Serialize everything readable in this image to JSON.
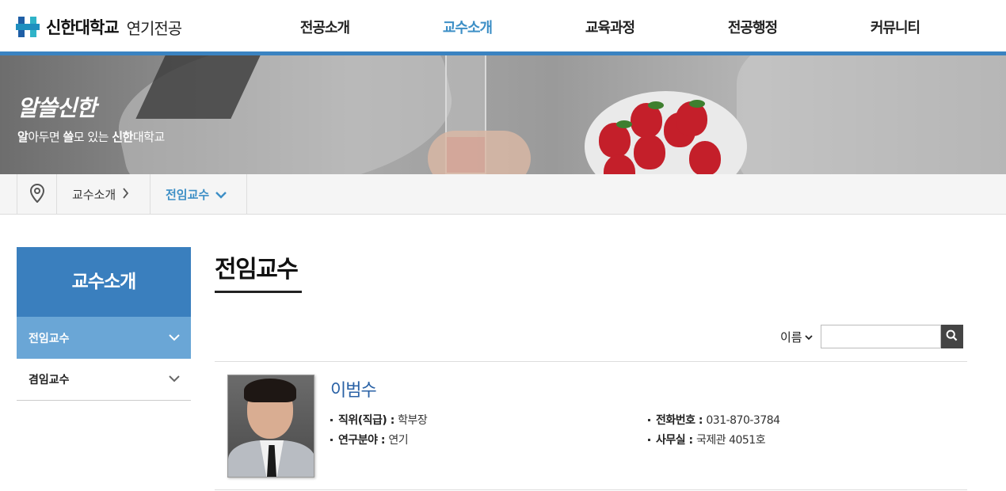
{
  "header": {
    "logo_univ": "신한대학교",
    "logo_major": "연기전공",
    "nav": [
      "전공소개",
      "교수소개",
      "교육과정",
      "전공행정",
      "커뮤니티"
    ],
    "active_nav": "교수소개",
    "accent_color": "#3a83c1"
  },
  "banner": {
    "title": "알쓸신한",
    "subtitle_parts": [
      "알",
      "아두면 ",
      "쓸",
      "모 있는 ",
      "신한",
      "대학교"
    ]
  },
  "breadcrumb": {
    "home_icon": "location-pin-icon",
    "level1": "교수소개",
    "level2": "전임교수"
  },
  "lnb": {
    "title": "교수소개",
    "items": [
      {
        "label": "전임교수",
        "active": true
      },
      {
        "label": "겸임교수",
        "active": false
      }
    ]
  },
  "main": {
    "title": "전임교수",
    "search": {
      "select_value": "이름",
      "input_value": "",
      "button_icon": "search-icon"
    },
    "professors": [
      {
        "name": "이범수",
        "position_label": "직위(직급) : ",
        "position": "학부장",
        "research_label": "연구분야 : ",
        "research": "연기",
        "phone_label": "전화번호 : ",
        "phone": "031-870-3784",
        "office_label": "사무실 : ",
        "office": "국제관 4051호"
      }
    ]
  }
}
